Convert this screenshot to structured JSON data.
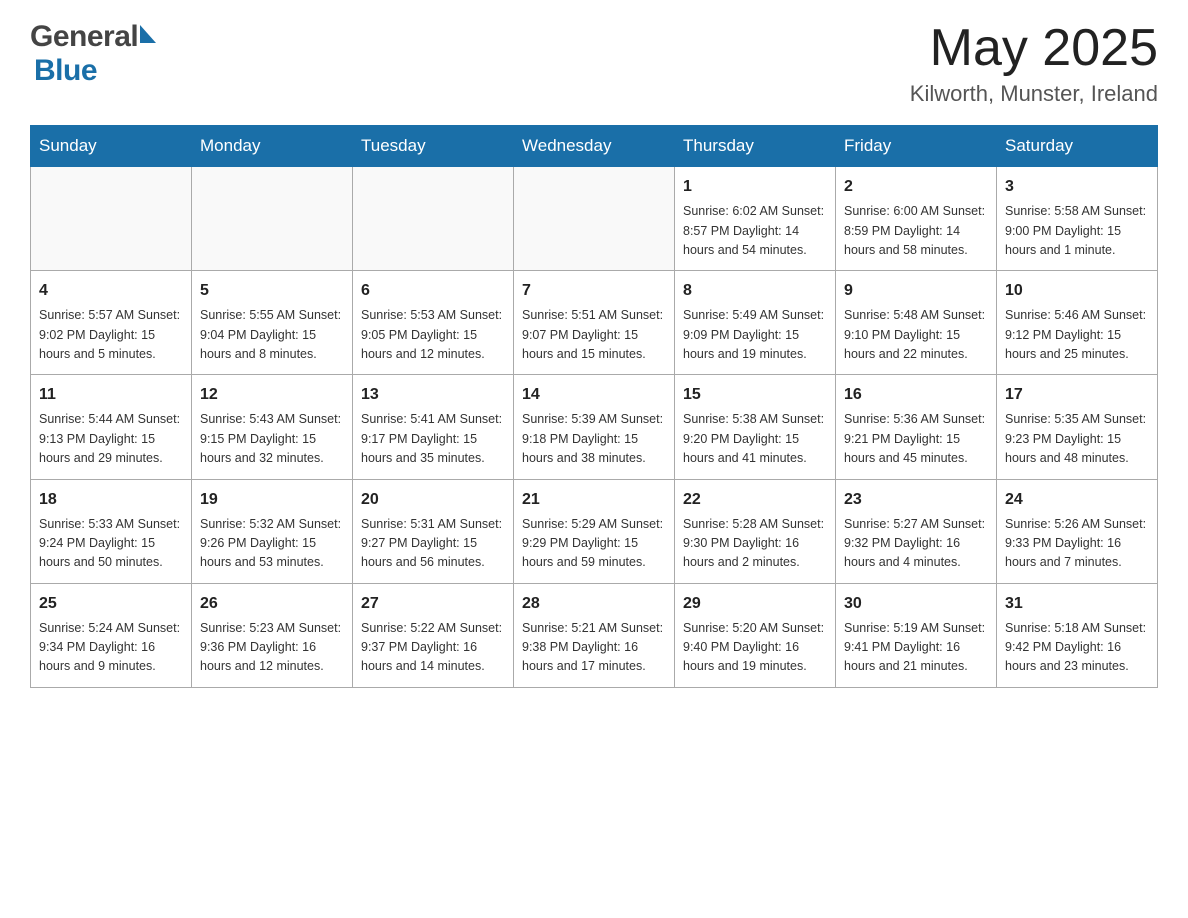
{
  "header": {
    "logo_general": "General",
    "logo_blue": "Blue",
    "month_title": "May 2025",
    "location": "Kilworth, Munster, Ireland"
  },
  "calendar": {
    "days_of_week": [
      "Sunday",
      "Monday",
      "Tuesday",
      "Wednesday",
      "Thursday",
      "Friday",
      "Saturday"
    ],
    "weeks": [
      [
        {
          "day": "",
          "info": ""
        },
        {
          "day": "",
          "info": ""
        },
        {
          "day": "",
          "info": ""
        },
        {
          "day": "",
          "info": ""
        },
        {
          "day": "1",
          "info": "Sunrise: 6:02 AM\nSunset: 8:57 PM\nDaylight: 14 hours\nand 54 minutes."
        },
        {
          "day": "2",
          "info": "Sunrise: 6:00 AM\nSunset: 8:59 PM\nDaylight: 14 hours\nand 58 minutes."
        },
        {
          "day": "3",
          "info": "Sunrise: 5:58 AM\nSunset: 9:00 PM\nDaylight: 15 hours\nand 1 minute."
        }
      ],
      [
        {
          "day": "4",
          "info": "Sunrise: 5:57 AM\nSunset: 9:02 PM\nDaylight: 15 hours\nand 5 minutes."
        },
        {
          "day": "5",
          "info": "Sunrise: 5:55 AM\nSunset: 9:04 PM\nDaylight: 15 hours\nand 8 minutes."
        },
        {
          "day": "6",
          "info": "Sunrise: 5:53 AM\nSunset: 9:05 PM\nDaylight: 15 hours\nand 12 minutes."
        },
        {
          "day": "7",
          "info": "Sunrise: 5:51 AM\nSunset: 9:07 PM\nDaylight: 15 hours\nand 15 minutes."
        },
        {
          "day": "8",
          "info": "Sunrise: 5:49 AM\nSunset: 9:09 PM\nDaylight: 15 hours\nand 19 minutes."
        },
        {
          "day": "9",
          "info": "Sunrise: 5:48 AM\nSunset: 9:10 PM\nDaylight: 15 hours\nand 22 minutes."
        },
        {
          "day": "10",
          "info": "Sunrise: 5:46 AM\nSunset: 9:12 PM\nDaylight: 15 hours\nand 25 minutes."
        }
      ],
      [
        {
          "day": "11",
          "info": "Sunrise: 5:44 AM\nSunset: 9:13 PM\nDaylight: 15 hours\nand 29 minutes."
        },
        {
          "day": "12",
          "info": "Sunrise: 5:43 AM\nSunset: 9:15 PM\nDaylight: 15 hours\nand 32 minutes."
        },
        {
          "day": "13",
          "info": "Sunrise: 5:41 AM\nSunset: 9:17 PM\nDaylight: 15 hours\nand 35 minutes."
        },
        {
          "day": "14",
          "info": "Sunrise: 5:39 AM\nSunset: 9:18 PM\nDaylight: 15 hours\nand 38 minutes."
        },
        {
          "day": "15",
          "info": "Sunrise: 5:38 AM\nSunset: 9:20 PM\nDaylight: 15 hours\nand 41 minutes."
        },
        {
          "day": "16",
          "info": "Sunrise: 5:36 AM\nSunset: 9:21 PM\nDaylight: 15 hours\nand 45 minutes."
        },
        {
          "day": "17",
          "info": "Sunrise: 5:35 AM\nSunset: 9:23 PM\nDaylight: 15 hours\nand 48 minutes."
        }
      ],
      [
        {
          "day": "18",
          "info": "Sunrise: 5:33 AM\nSunset: 9:24 PM\nDaylight: 15 hours\nand 50 minutes."
        },
        {
          "day": "19",
          "info": "Sunrise: 5:32 AM\nSunset: 9:26 PM\nDaylight: 15 hours\nand 53 minutes."
        },
        {
          "day": "20",
          "info": "Sunrise: 5:31 AM\nSunset: 9:27 PM\nDaylight: 15 hours\nand 56 minutes."
        },
        {
          "day": "21",
          "info": "Sunrise: 5:29 AM\nSunset: 9:29 PM\nDaylight: 15 hours\nand 59 minutes."
        },
        {
          "day": "22",
          "info": "Sunrise: 5:28 AM\nSunset: 9:30 PM\nDaylight: 16 hours\nand 2 minutes."
        },
        {
          "day": "23",
          "info": "Sunrise: 5:27 AM\nSunset: 9:32 PM\nDaylight: 16 hours\nand 4 minutes."
        },
        {
          "day": "24",
          "info": "Sunrise: 5:26 AM\nSunset: 9:33 PM\nDaylight: 16 hours\nand 7 minutes."
        }
      ],
      [
        {
          "day": "25",
          "info": "Sunrise: 5:24 AM\nSunset: 9:34 PM\nDaylight: 16 hours\nand 9 minutes."
        },
        {
          "day": "26",
          "info": "Sunrise: 5:23 AM\nSunset: 9:36 PM\nDaylight: 16 hours\nand 12 minutes."
        },
        {
          "day": "27",
          "info": "Sunrise: 5:22 AM\nSunset: 9:37 PM\nDaylight: 16 hours\nand 14 minutes."
        },
        {
          "day": "28",
          "info": "Sunrise: 5:21 AM\nSunset: 9:38 PM\nDaylight: 16 hours\nand 17 minutes."
        },
        {
          "day": "29",
          "info": "Sunrise: 5:20 AM\nSunset: 9:40 PM\nDaylight: 16 hours\nand 19 minutes."
        },
        {
          "day": "30",
          "info": "Sunrise: 5:19 AM\nSunset: 9:41 PM\nDaylight: 16 hours\nand 21 minutes."
        },
        {
          "day": "31",
          "info": "Sunrise: 5:18 AM\nSunset: 9:42 PM\nDaylight: 16 hours\nand 23 minutes."
        }
      ]
    ]
  }
}
